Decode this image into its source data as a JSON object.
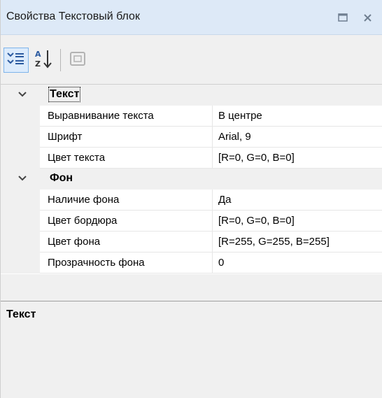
{
  "window": {
    "title": "Свойства Текстовый блок",
    "maximize_icon": "restore-window-icon",
    "close_icon": "close-icon"
  },
  "toolbar": {
    "buttons": [
      {
        "name": "categorized",
        "icon": "categorized-view-icon",
        "active": true
      },
      {
        "name": "alphabetical",
        "icon": "sort-alphabetical-icon",
        "active": false
      },
      {
        "name": "property-pages",
        "icon": "property-pages-icon",
        "active": false
      }
    ]
  },
  "grid": {
    "categories": [
      {
        "label": "Текст",
        "expanded": true,
        "properties": [
          {
            "name": "Выравнивание текста",
            "value": "В центре"
          },
          {
            "name": "Шрифт",
            "value": "Arial, 9"
          },
          {
            "name": "Цвет текста",
            "value": "[R=0, G=0, B=0]"
          }
        ]
      },
      {
        "label": "Фон",
        "expanded": true,
        "properties": [
          {
            "name": "Наличие фона",
            "value": "Да"
          },
          {
            "name": "Цвет бордюра",
            "value": "[R=0, G=0, B=0]"
          },
          {
            "name": "Цвет фона",
            "value": "[R=255, G=255, B=255]"
          },
          {
            "name": "Прозрачность фона",
            "value": "0"
          }
        ]
      }
    ]
  },
  "description": {
    "title": "Текст",
    "body": ""
  },
  "colors": {
    "titlebar": "#dde9f7",
    "panel": "#f0f0f0",
    "grid_line": "#e6e6e6",
    "active_button_border": "#7eb4ea"
  }
}
